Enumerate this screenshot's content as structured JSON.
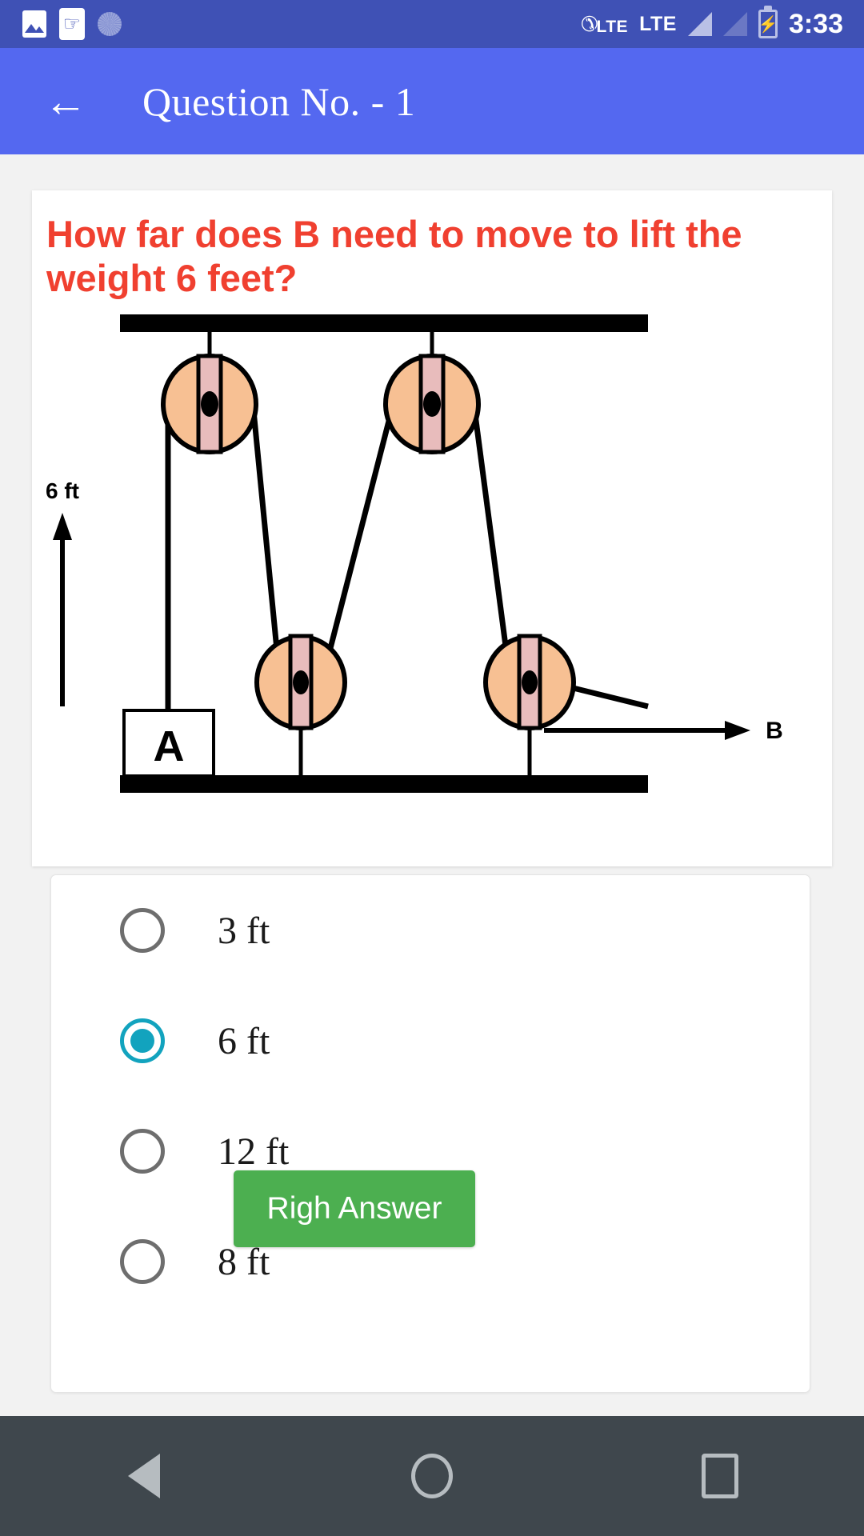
{
  "status_bar": {
    "icons_left": [
      "gallery-icon",
      "usb-icon",
      "disc-icon"
    ],
    "phone_icon": "phone-call-icon",
    "network_1": "LTE",
    "network_2": "LTE",
    "signal_1": "signal-full-icon",
    "signal_2": "signal-empty-icon",
    "battery": "battery-charging-icon",
    "battery_glyph": "⚡",
    "time": "3:33"
  },
  "app_bar": {
    "back_icon": "←",
    "back_icon_name": "back-arrow-icon",
    "title": "Question No. - 1",
    "background": "#5468f0"
  },
  "question": {
    "text": "How far does B need to move to lift the weight 6 feet?",
    "color": "#f04030"
  },
  "diagram": {
    "label_distance": "6 ft",
    "label_block": "A",
    "label_force": "B",
    "pulley_fill": "#f7c093",
    "axle_fill": "#e8bcbc",
    "beam_color": "#000000",
    "rope_color": "#000000",
    "top_pulleys": 2,
    "bottom_pulleys": 2,
    "description": "Block and tackle: two fixed pulleys on the ceiling beam and two movable pulleys anchored to the floor beam; weight A hangs on the left, force B pulls horizontally to the right."
  },
  "options": {
    "selected_index": 1,
    "selected_color": "#12a3be",
    "unselected_color": "#6e6e6e",
    "items": [
      {
        "label": "3 ft",
        "selected": false
      },
      {
        "label": "6 ft",
        "selected": true
      },
      {
        "label": "12 ft",
        "selected": false
      },
      {
        "label": "8 ft",
        "selected": false
      }
    ]
  },
  "feedback": {
    "button_label": "Righ Answer",
    "button_color": "#4caf50"
  },
  "nav_bar": {
    "back": "nav-back-icon",
    "home": "nav-home-icon",
    "recents": "nav-recents-icon"
  }
}
